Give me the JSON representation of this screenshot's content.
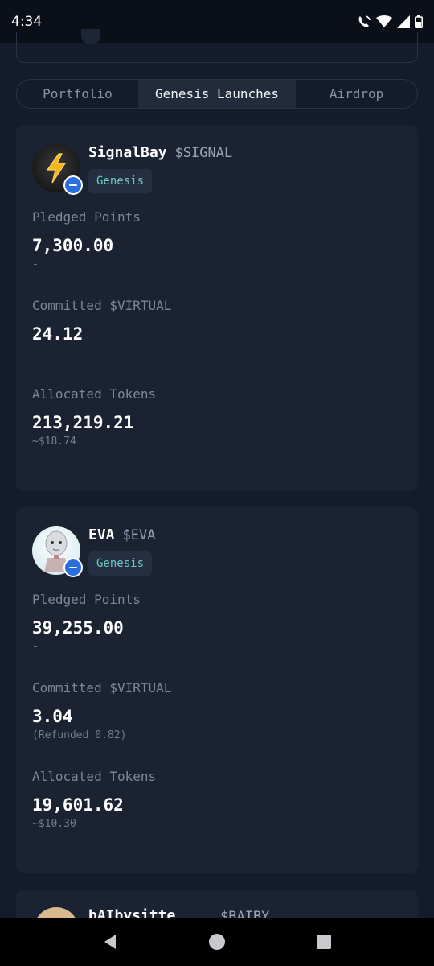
{
  "status_bar": {
    "time": "4:34"
  },
  "tabs": [
    {
      "label": "Portfolio",
      "active": false
    },
    {
      "label": "Genesis Launches",
      "active": true
    },
    {
      "label": "Airdrop",
      "active": false
    }
  ],
  "colors": {
    "accent_teal": "#6fc8c8",
    "badge_blue": "#2a6fe0",
    "background": "#141b2b",
    "card": "#1b2232"
  },
  "cards": [
    {
      "name": "SignalBay",
      "ticker": "$SIGNAL",
      "tag": "Genesis",
      "avatar_icon": "lightning-bolt-icon",
      "metrics": [
        {
          "label": "Pledged Points",
          "value": "7,300.00",
          "sub": "-"
        },
        {
          "label": "Committed $VIRTUAL",
          "value": "24.12",
          "sub": "-"
        },
        {
          "label": "Allocated Tokens",
          "value": "213,219.21",
          "sub": "~$18.74"
        }
      ]
    },
    {
      "name": "EVA",
      "ticker": "$EVA",
      "tag": "Genesis",
      "avatar_icon": "robot-face-icon",
      "metrics": [
        {
          "label": "Pledged Points",
          "value": "39,255.00",
          "sub": "-"
        },
        {
          "label": "Committed $VIRTUAL",
          "value": "3.04",
          "sub": "(Refunded 0.82)"
        },
        {
          "label": "Allocated Tokens",
          "value": "19,601.62",
          "sub": "~$10.30"
        }
      ]
    }
  ],
  "partial_card": {
    "name": "bAIbysitte",
    "ticker": "$BAIBY"
  }
}
